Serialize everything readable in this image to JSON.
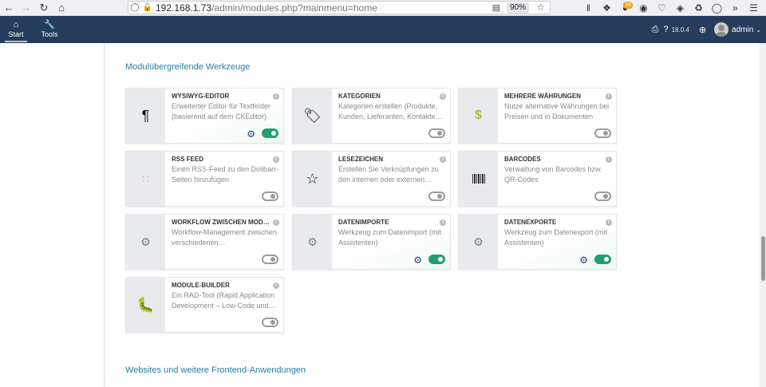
{
  "browser": {
    "url_host": "192.168.1.73",
    "url_path": "/admin/modules.php?mainmenu=home",
    "zoom": "90%"
  },
  "appbar": {
    "menu": [
      {
        "label": "Start",
        "icon": "home-icon"
      },
      {
        "label": "Tools",
        "icon": "wrench-icon"
      }
    ],
    "version": "18.0.4",
    "user": "admin"
  },
  "section1_title": "Modulübergreifende Werkzeuge",
  "section2_title": "Websites und weitere Frontend-Anwendungen",
  "cards": [
    {
      "title": "WYSIWYG-EDITOR",
      "desc": "Erweiterter Editor für Textfelder (basierend auf dem CKEditor)",
      "icon": "paragraph-icon",
      "enabled": true,
      "has_settings": true
    },
    {
      "title": "KATEGORIEN",
      "desc": "Kategorien erstellen (Produkte, Kunden, Lieferanten, Kontakte…",
      "icon": "tag-icon",
      "enabled": false,
      "has_settings": false
    },
    {
      "title": "MEHRERE WÄHRUNGEN",
      "desc": "Nutze alternative Währungen bei Preisen und in Dokumenten",
      "icon": "dollar-icon",
      "enabled": false,
      "has_settings": false
    },
    {
      "title": "RSS FEED",
      "desc": "Einen RSS-Feed zu den Dolibarr-Seiten hinzufügen",
      "icon": "rss-icon",
      "enabled": false,
      "has_settings": false
    },
    {
      "title": "LESEZEICHEN",
      "desc": "Erstellen Sie Verknüpfungen zu den internen oder externen…",
      "icon": "star-icon",
      "enabled": false,
      "has_settings": false
    },
    {
      "title": "BARCODES",
      "desc": "Verwaltung von Barcodes bzw. QR-Codes",
      "icon": "barcode-icon",
      "enabled": false,
      "has_settings": false
    },
    {
      "title": "WORKFLOW ZWISCHEN MODULEN",
      "desc": "Workflow-Management zwischen verschiedenen…",
      "icon": "cogs-icon",
      "enabled": false,
      "has_settings": false
    },
    {
      "title": "DATENIMPORTE",
      "desc": "Werkzeug zum Datenimport (mit Assistenten)",
      "icon": "cogs-icon",
      "enabled": true,
      "has_settings": true
    },
    {
      "title": "DATENEXPORTE",
      "desc": "Werkzeug zum Datenexport (mit Assistenten)",
      "icon": "cogs-icon",
      "enabled": true,
      "has_settings": true
    },
    {
      "title": "MODULE-BUILDER",
      "desc": "Ein RAD-Tool (Rapid Application Development – Low-Code und…",
      "icon": "bug-icon",
      "enabled": false,
      "has_settings": false
    }
  ]
}
